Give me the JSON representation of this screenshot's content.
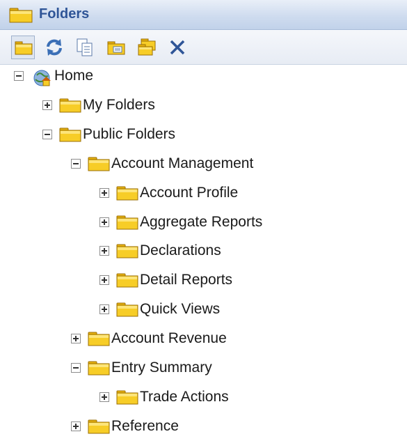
{
  "panel": {
    "title": "Folders"
  },
  "toolbar": {
    "buttons": [
      {
        "icon": "folder-icon",
        "pressed": true
      },
      {
        "icon": "refresh-icon",
        "pressed": false
      },
      {
        "icon": "copy-icon",
        "pressed": false
      },
      {
        "icon": "folder-properties-icon",
        "pressed": false
      },
      {
        "icon": "new-folder-icon",
        "pressed": false
      },
      {
        "icon": "delete-icon",
        "pressed": false
      }
    ]
  },
  "tree": {
    "nodes": [
      {
        "label": "Home",
        "level": 0,
        "expanded": true,
        "icon": "home-icon"
      },
      {
        "label": "My Folders",
        "level": 1,
        "expanded": false,
        "icon": "folder-icon"
      },
      {
        "label": "Public Folders",
        "level": 1,
        "expanded": true,
        "icon": "folder-icon"
      },
      {
        "label": "Account Management",
        "level": 2,
        "expanded": true,
        "icon": "folder-icon"
      },
      {
        "label": "Account Profile",
        "level": 3,
        "expanded": false,
        "icon": "folder-icon"
      },
      {
        "label": "Aggregate Reports",
        "level": 3,
        "expanded": false,
        "icon": "folder-icon"
      },
      {
        "label": "Declarations",
        "level": 3,
        "expanded": false,
        "icon": "folder-icon"
      },
      {
        "label": "Detail Reports",
        "level": 3,
        "expanded": false,
        "icon": "folder-icon"
      },
      {
        "label": "Quick Views",
        "level": 3,
        "expanded": false,
        "icon": "folder-icon"
      },
      {
        "label": "Account Revenue",
        "level": 2,
        "expanded": false,
        "icon": "folder-icon"
      },
      {
        "label": "Entry Summary",
        "level": 2,
        "expanded": true,
        "icon": "folder-icon"
      },
      {
        "label": "Trade Actions",
        "level": 3,
        "expanded": false,
        "icon": "folder-icon"
      },
      {
        "label": "Reference",
        "level": 2,
        "expanded": false,
        "icon": "folder-icon"
      }
    ]
  },
  "colors": {
    "title_text": "#2f5597",
    "folder_fill": "#f5c518",
    "folder_dark": "#c9920a",
    "delete_x": "#2f5597"
  }
}
